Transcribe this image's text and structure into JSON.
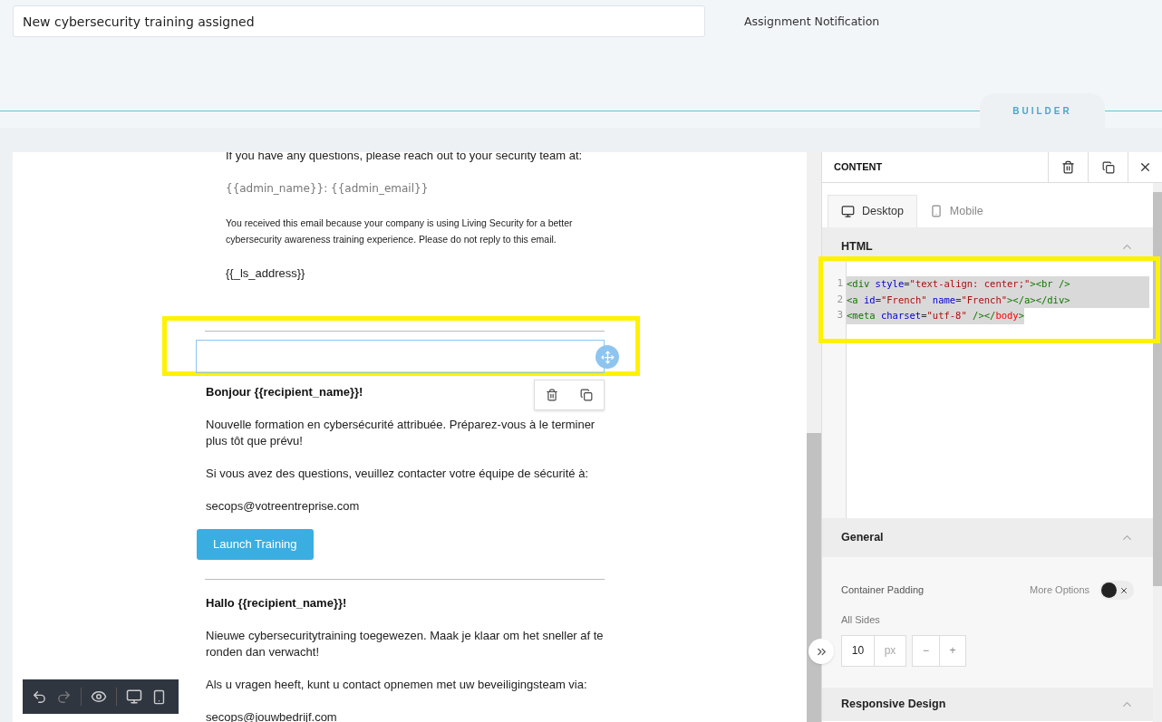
{
  "header": {
    "subject": {
      "value": "New cybersecurity training assigned"
    },
    "notification_label": "Assignment Notification",
    "builder_tab": "BUILDER"
  },
  "canvas": {
    "blocks": [
      {
        "kind": "text",
        "indent": true,
        "text": "If you have any questions, please reach out to your security team at:",
        "selected": false
      },
      {
        "kind": "muted",
        "indent": true,
        "text": "{{admin_name}}: {{admin_email}}",
        "selected": false
      },
      {
        "kind": "small",
        "indent": true,
        "text": "You received this email because your company is using Living Security for a better cybersecurity awareness training experience. Please do not reply to this email.",
        "selected": false
      },
      {
        "kind": "text",
        "indent": true,
        "text": "{{_ls_address}}",
        "selected": false
      },
      {
        "kind": "divider",
        "selected": false
      },
      {
        "kind": "empty",
        "selected": true,
        "highlighted": true
      },
      {
        "kind": "heading",
        "text": "Bonjour {{recipient_name}}!",
        "selected": false
      },
      {
        "kind": "text",
        "text": "Nouvelle formation en cybersécurité attribuée. Préparez-vous à le terminer plus tôt que prévu!",
        "selected": false
      },
      {
        "kind": "text",
        "text": "Si vous avez des questions, veuillez contacter votre équipe de sécurité à:",
        "selected": false
      },
      {
        "kind": "text",
        "text": "secops@votreentreprise.com",
        "selected": false
      },
      {
        "kind": "button",
        "text": "Launch Training",
        "selected": false
      },
      {
        "kind": "divider",
        "selected": false
      },
      {
        "kind": "heading",
        "text": "Hallo {{recipient_name}}!",
        "selected": false
      },
      {
        "kind": "text",
        "text": "Nieuwe cybersecuritytraining toegewezen. Maak je klaar om het sneller af te ronden dan verwacht!",
        "selected": false
      },
      {
        "kind": "text",
        "text": "Als u vragen heeft, kunt u contact opnemen met uw beveiligingsteam via:",
        "selected": false
      },
      {
        "kind": "text",
        "text": "secops@jouwbedrijf.com",
        "selected": false
      }
    ]
  },
  "panel": {
    "title": "CONTENT",
    "tabs": [
      {
        "label": "Desktop",
        "selected": true
      },
      {
        "label": "Mobile",
        "selected": false
      }
    ],
    "html_section": {
      "title": "HTML",
      "expanded": true,
      "highlighted": true,
      "lines": [
        {
          "number": "1",
          "tokens": [
            {
              "kind": "tag",
              "text": "<div"
            },
            {
              "kind": "attr",
              "text": " style"
            },
            {
              "kind": "punct",
              "text": "="
            },
            {
              "kind": "string",
              "text": "\"text-align: center;\""
            },
            {
              "kind": "tag",
              "text": "><br />"
            }
          ]
        },
        {
          "number": "2",
          "tokens": [
            {
              "kind": "tag",
              "text": "<a"
            },
            {
              "kind": "attr",
              "text": " id"
            },
            {
              "kind": "punct",
              "text": "="
            },
            {
              "kind": "string",
              "text": "\"French\""
            },
            {
              "kind": "attr",
              "text": " name"
            },
            {
              "kind": "punct",
              "text": "="
            },
            {
              "kind": "string",
              "text": "\"French\""
            },
            {
              "kind": "tag",
              "text": "></a></div>"
            }
          ]
        },
        {
          "number": "3",
          "tokens": [
            {
              "kind": "tag",
              "text": "<meta"
            },
            {
              "kind": "attr",
              "text": " charset"
            },
            {
              "kind": "punct",
              "text": "="
            },
            {
              "kind": "string",
              "text": "\"utf-8\""
            },
            {
              "kind": "tag",
              "text": " /></"
            },
            {
              "kind": "error",
              "text": "body"
            },
            {
              "kind": "tag",
              "text": ">"
            }
          ]
        }
      ]
    },
    "general": {
      "title": "General",
      "expanded": true,
      "padding_label": "Container Padding",
      "more_options": "More Options",
      "more_options_on": false,
      "all_sides": "All Sides",
      "value": "10",
      "unit": "px",
      "minus": "−",
      "plus": "+"
    },
    "responsive": {
      "title": "Responsive Design",
      "expanded": true
    }
  }
}
